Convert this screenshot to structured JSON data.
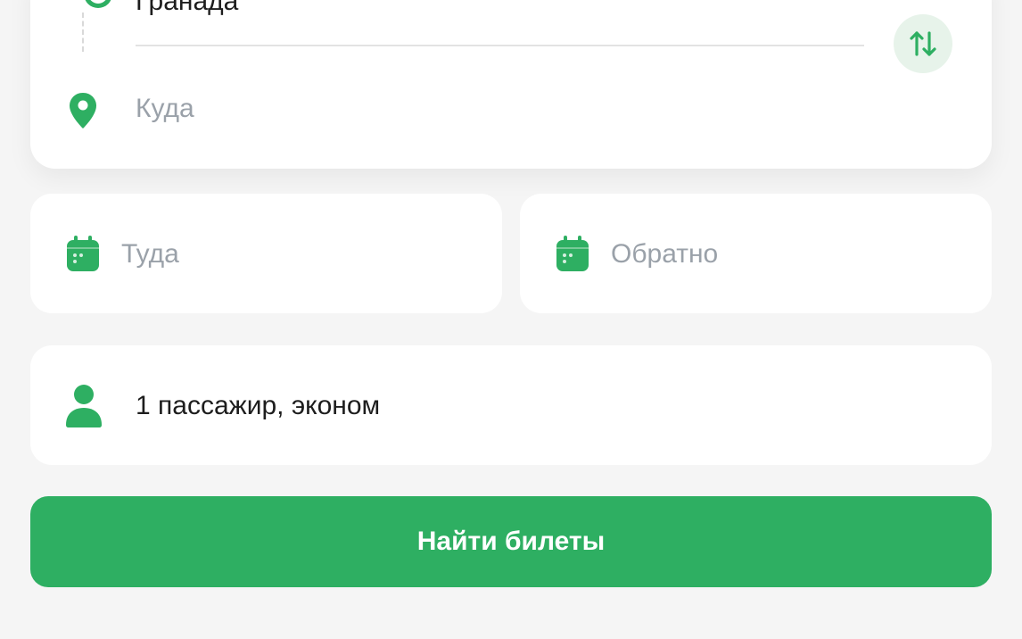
{
  "route": {
    "origin_value": "Гранада",
    "destination_placeholder": "Куда"
  },
  "dates": {
    "there_placeholder": "Туда",
    "back_placeholder": "Обратно"
  },
  "passengers": {
    "summary": "1 пассажир, эконом"
  },
  "search": {
    "button_label": "Найти билеты"
  },
  "colors": {
    "accent": "#2eaf62",
    "accent_light": "#e7f3ea",
    "placeholder": "#9aa1a9",
    "text": "#1d1d1d",
    "background": "#f5f5f5"
  },
  "icons": {
    "origin": "origin-marker-icon",
    "destination": "map-pin-icon",
    "swap": "swap-arrows-icon",
    "date": "calendar-icon",
    "passengers": "person-icon"
  }
}
